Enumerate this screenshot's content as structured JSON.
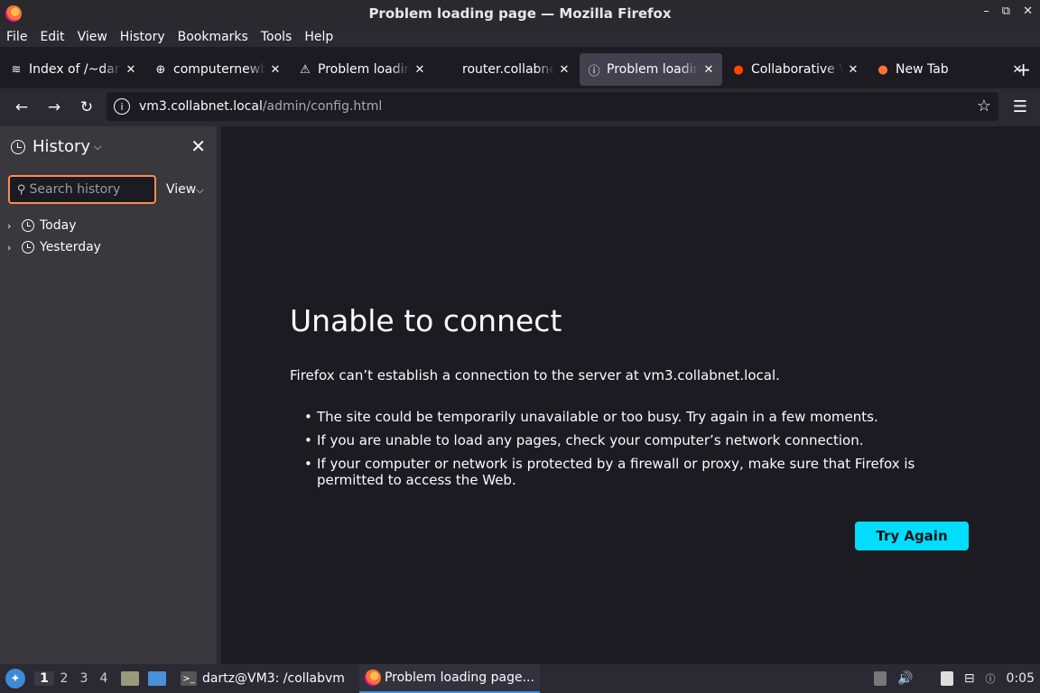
{
  "window": {
    "title": "Problem loading page — Mozilla Firefox",
    "controls": [
      "–",
      "⧉",
      "✕"
    ]
  },
  "menu": [
    "File",
    "Edit",
    "View",
    "History",
    "Bookmarks",
    "Tools",
    "Help"
  ],
  "tabs": [
    {
      "label": "Index of /~dartz",
      "icon": "stack-icon",
      "glyph": "≋",
      "active": false
    },
    {
      "label": "computernewb.com",
      "icon": "globe-icon",
      "glyph": "⊕",
      "active": false
    },
    {
      "label": "Problem loading page",
      "icon": "warning-icon",
      "glyph": "⚠",
      "active": false
    },
    {
      "label": "router.collabnet.local",
      "icon": "",
      "glyph": "",
      "active": false
    },
    {
      "label": "Problem loading page",
      "icon": "info-icon",
      "glyph": "ⓘ",
      "active": true
    },
    {
      "label": "Collaborative Virtual Machine",
      "icon": "reddit-icon",
      "glyph": "●",
      "active": false
    },
    {
      "label": "New Tab",
      "icon": "firefox-icon",
      "glyph": "●",
      "active": false
    }
  ],
  "nav": {
    "url_host": "vm3.collabnet.local",
    "url_path": "/admin/config.html"
  },
  "sidebar": {
    "title": "History",
    "search_placeholder": "Search history",
    "view_label": "View",
    "items": [
      "Today",
      "Yesterday"
    ]
  },
  "error": {
    "title": "Unable to connect",
    "description": "Firefox can’t establish a connection to the server at vm3.collabnet.local.",
    "bullets": [
      "The site could be temporarily unavailable or too busy. Try again in a few moments.",
      "If you are unable to load any pages, check your computer’s network connection.",
      "If your computer or network is protected by a firewall or proxy, make sure that Firefox is permitted to access the Web."
    ],
    "button": "Try Again"
  },
  "taskbar": {
    "workspaces": [
      "1",
      "2",
      "3",
      "4"
    ],
    "tasks": [
      "dartz@VM3: /collabvm",
      "Problem loading page..."
    ],
    "clock": "0:05"
  },
  "colors": {
    "accent": "#00ddff",
    "focus_ring": "#ff8a50",
    "background": "#1c1b22"
  }
}
